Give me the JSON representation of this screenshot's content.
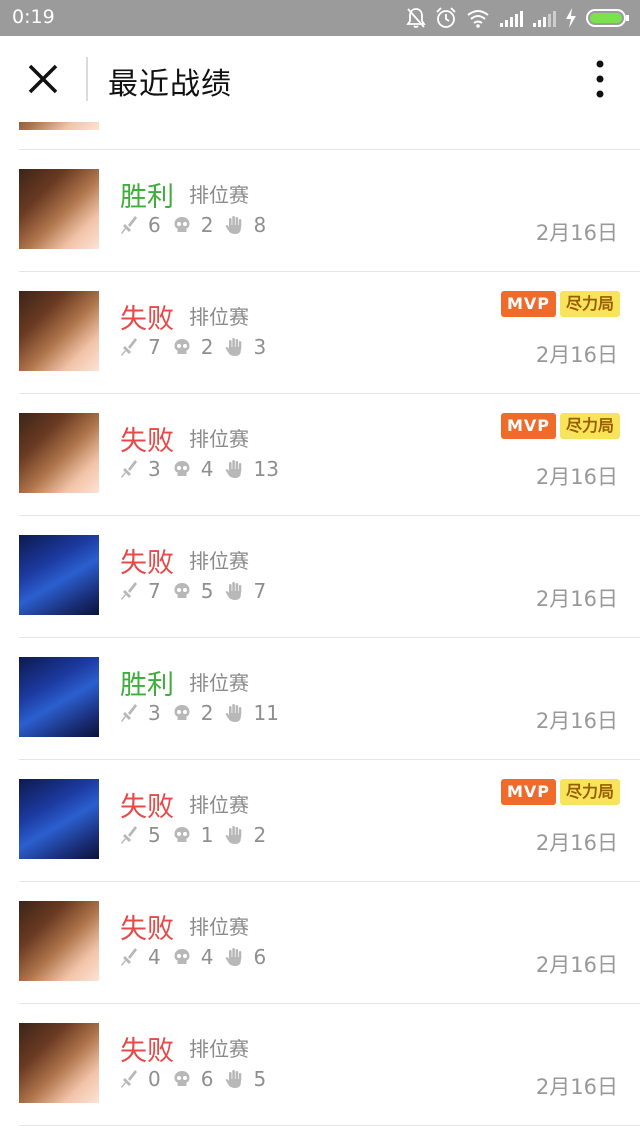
{
  "status_bar": {
    "time": "0:19"
  },
  "header": {
    "title": "最近战绩"
  },
  "records": [
    {
      "result": "胜利",
      "outcome": "win",
      "mode": "排位赛",
      "kills": "6",
      "deaths": "2",
      "assists": "8",
      "date": "2月16日",
      "hero": "hero-a",
      "badges": []
    },
    {
      "result": "失败",
      "outcome": "loss",
      "mode": "排位赛",
      "kills": "7",
      "deaths": "2",
      "assists": "3",
      "date": "2月16日",
      "hero": "hero-a",
      "badges": [
        "MVP",
        "尽力局"
      ]
    },
    {
      "result": "失败",
      "outcome": "loss",
      "mode": "排位赛",
      "kills": "3",
      "deaths": "4",
      "assists": "13",
      "date": "2月16日",
      "hero": "hero-a",
      "badges": [
        "MVP",
        "尽力局"
      ]
    },
    {
      "result": "失败",
      "outcome": "loss",
      "mode": "排位赛",
      "kills": "7",
      "deaths": "5",
      "assists": "7",
      "date": "2月16日",
      "hero": "hero-b",
      "badges": []
    },
    {
      "result": "胜利",
      "outcome": "win",
      "mode": "排位赛",
      "kills": "3",
      "deaths": "2",
      "assists": "11",
      "date": "2月16日",
      "hero": "hero-b",
      "badges": []
    },
    {
      "result": "失败",
      "outcome": "loss",
      "mode": "排位赛",
      "kills": "5",
      "deaths": "1",
      "assists": "2",
      "date": "2月16日",
      "hero": "hero-b",
      "badges": [
        "MVP",
        "尽力局"
      ]
    },
    {
      "result": "失败",
      "outcome": "loss",
      "mode": "排位赛",
      "kills": "4",
      "deaths": "4",
      "assists": "6",
      "date": "2月16日",
      "hero": "hero-a",
      "badges": []
    },
    {
      "result": "失败",
      "outcome": "loss",
      "mode": "排位赛",
      "kills": "0",
      "deaths": "6",
      "assists": "5",
      "date": "2月16日",
      "hero": "hero-a",
      "badges": []
    }
  ],
  "colors": {
    "win": "#3fae3a",
    "loss": "#e84848",
    "mvp": "#f06a2a",
    "effort": "#f7e45a"
  },
  "icons": {
    "kills": "sword-icon",
    "deaths": "skull-icon",
    "assists": "hand-icon"
  }
}
